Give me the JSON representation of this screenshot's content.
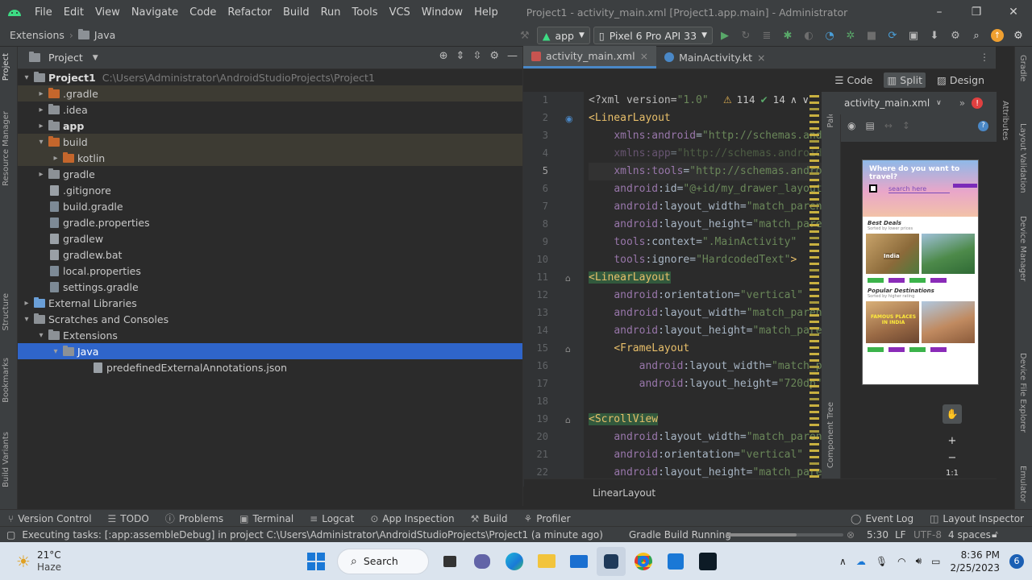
{
  "window": {
    "title": "Project1 - activity_main.xml [Project1.app.main] - Administrator",
    "menu": [
      "File",
      "Edit",
      "View",
      "Navigate",
      "Code",
      "Refactor",
      "Build",
      "Run",
      "Tools",
      "VCS",
      "Window",
      "Help"
    ],
    "controls": {
      "minimize": "–",
      "maximize": "❐",
      "close": "✕"
    }
  },
  "navbar": {
    "breadcrumb": [
      "Extensions",
      "Java"
    ],
    "run_config": "app",
    "device": "Pixel 6 Pro API 33"
  },
  "left_strip": [
    "Project",
    "Resource Manager",
    "Structure",
    "Bookmarks",
    "Build Variants"
  ],
  "project_panel": {
    "title": "Project",
    "tree": [
      {
        "label": "Project1",
        "path": "C:\\Users\\Administrator\\AndroidStudioProjects\\Project1",
        "indent": 0,
        "arrow": "▾",
        "kind": "root"
      },
      {
        "label": ".gradle",
        "indent": 1,
        "arrow": "▸",
        "kind": "folder-orange",
        "excluded": true
      },
      {
        "label": ".idea",
        "indent": 1,
        "arrow": "▸",
        "kind": "folder"
      },
      {
        "label": "app",
        "indent": 1,
        "arrow": "▸",
        "kind": "folder-module",
        "bold": true
      },
      {
        "label": "build",
        "indent": 1,
        "arrow": "▾",
        "kind": "folder-orange",
        "excluded": true
      },
      {
        "label": "kotlin",
        "indent": 2,
        "arrow": "▸",
        "kind": "folder-orange",
        "excluded": true
      },
      {
        "label": "gradle",
        "indent": 1,
        "arrow": "▸",
        "kind": "folder"
      },
      {
        "label": ".gitignore",
        "indent": 1,
        "arrow": "",
        "kind": "file"
      },
      {
        "label": "build.gradle",
        "indent": 1,
        "arrow": "",
        "kind": "file-gradle"
      },
      {
        "label": "gradle.properties",
        "indent": 1,
        "arrow": "",
        "kind": "file-gradle"
      },
      {
        "label": "gradlew",
        "indent": 1,
        "arrow": "",
        "kind": "file"
      },
      {
        "label": "gradlew.bat",
        "indent": 1,
        "arrow": "",
        "kind": "file"
      },
      {
        "label": "local.properties",
        "indent": 1,
        "arrow": "",
        "kind": "file-gradle"
      },
      {
        "label": "settings.gradle",
        "indent": 1,
        "arrow": "",
        "kind": "file-gradle"
      },
      {
        "label": "External Libraries",
        "indent": 0,
        "arrow": "▸",
        "kind": "lib"
      },
      {
        "label": "Scratches and Consoles",
        "indent": 0,
        "arrow": "▾",
        "kind": "scratch"
      },
      {
        "label": "Extensions",
        "indent": 1,
        "arrow": "▾",
        "kind": "folder"
      },
      {
        "label": "Java",
        "indent": 2,
        "arrow": "▾",
        "kind": "folder",
        "selected": true
      },
      {
        "label": "predefinedExternalAnnotations.json",
        "indent": 4,
        "arrow": "",
        "kind": "file"
      }
    ]
  },
  "editor": {
    "tabs": [
      {
        "label": "activity_main.xml",
        "active": true
      },
      {
        "label": "MainActivity.kt",
        "active": false
      }
    ],
    "modes": [
      "Code",
      "Split",
      "Design"
    ],
    "inspection": {
      "warnings": "114",
      "ok": "14"
    },
    "line_numbers": [
      "1",
      "2",
      "3",
      "4",
      "5",
      "6",
      "7",
      "8",
      "9",
      "10",
      "11",
      "12",
      "13",
      "14",
      "15",
      "16",
      "17",
      "18",
      "19",
      "20",
      "21",
      "22"
    ],
    "bottom_crumb": "LinearLayout"
  },
  "design": {
    "file": "activity_main.xml",
    "palette": "Palette",
    "component_tree": "Component Tree",
    "phone": {
      "header": "Where do you want to travel?",
      "search": "search here",
      "section1": "Best Deals",
      "section1_sub": "Sorted by lower prices",
      "card_label": "India",
      "section2": "Popular Destinations",
      "section2_sub": "Sorted by higher rating",
      "card2_label": "FAMOUS PLACES IN INDIA",
      "btn": "BOOK"
    },
    "zoom_fit": "1:1"
  },
  "right_strip": [
    "Gradle",
    "Layout Validation",
    "Device Manager",
    "Device File Explorer",
    "Emulator",
    "Attributes"
  ],
  "tool_windows": [
    "Version Control",
    "TODO",
    "Problems",
    "Terminal",
    "Logcat",
    "App Inspection",
    "Build",
    "Profiler"
  ],
  "tool_windows_right": [
    "Event Log",
    "Layout Inspector"
  ],
  "status": {
    "message": "Executing tasks: [:app:assembleDebug] in project C:\\Users\\Administrator\\AndroidStudioProjects\\Project1 (a minute ago)",
    "task": "Gradle Build Running",
    "position": "5:30",
    "line_sep": "LF",
    "encoding": "UTF-8",
    "indent": "4 spaces"
  },
  "taskbar": {
    "weather_temp": "21°C",
    "weather_desc": "Haze",
    "search": "Search",
    "time": "8:36 PM",
    "date": "2/25/2023",
    "badge": "6"
  }
}
